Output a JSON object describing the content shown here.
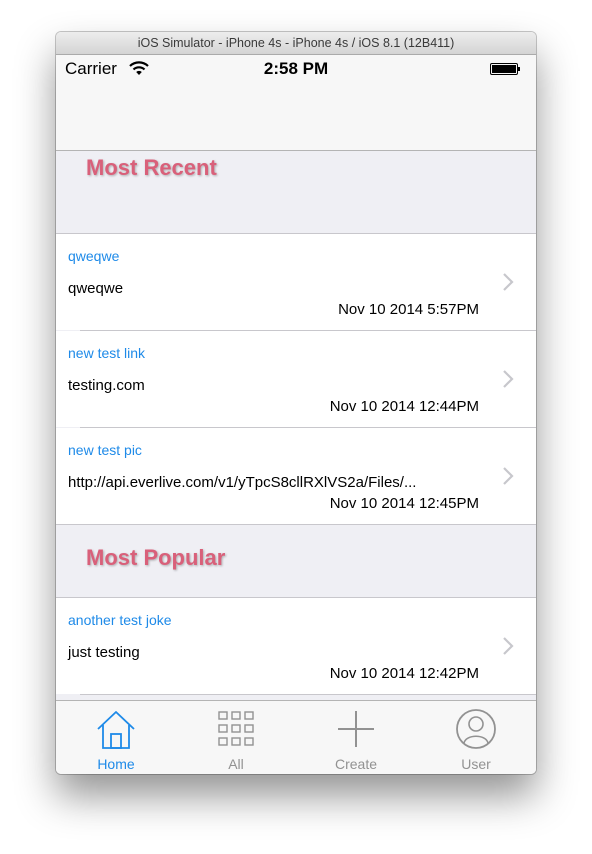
{
  "window": {
    "title": "iOS Simulator - iPhone 4s - iPhone 4s / iOS 8.1 (12B411)"
  },
  "status_bar": {
    "carrier": "Carrier",
    "time": "2:58 PM"
  },
  "sections": [
    {
      "title": "Most Recent",
      "rows": [
        {
          "title": "qweqwe",
          "subtitle": "qweqwe",
          "date": "Nov 10 2014  5:57PM"
        },
        {
          "title": "new test link",
          "subtitle": "testing.com",
          "date": "Nov 10 2014 12:44PM"
        },
        {
          "title": "new test pic",
          "subtitle": "http://api.everlive.com/v1/yTpcS8cllRXlVS2a/Files/...",
          "date": "Nov 10 2014 12:45PM"
        }
      ]
    },
    {
      "title": "Most Popular",
      "rows": [
        {
          "title": "another test joke",
          "subtitle": "just testing",
          "date": "Nov 10 2014 12:42PM"
        }
      ]
    }
  ],
  "tab_bar": {
    "active_index": 0,
    "tabs": [
      {
        "label": "Home",
        "icon": "home-icon"
      },
      {
        "label": "All",
        "icon": "grid-icon"
      },
      {
        "label": "Create",
        "icon": "plus-icon"
      },
      {
        "label": "User",
        "icon": "user-icon"
      }
    ]
  },
  "colors": {
    "accent": "#1e8ae8",
    "section_title": "#d9607a",
    "inactive_tab": "#929292",
    "group_background": "#efeff4"
  }
}
